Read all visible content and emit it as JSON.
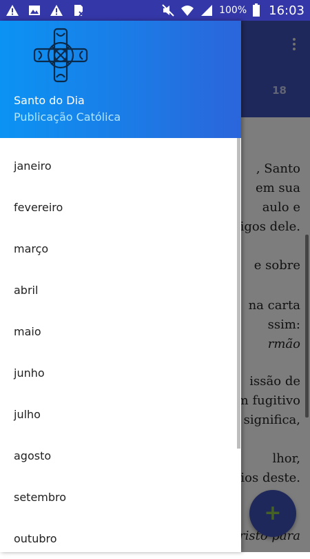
{
  "status_bar": {
    "battery": "100%",
    "time": "16:03",
    "left_icons": [
      "warning-icon",
      "image-icon",
      "warning-icon",
      "sim-icon"
    ],
    "right_icons": [
      "mute-icon",
      "wifi-icon",
      "signal-icon",
      "battery-icon"
    ]
  },
  "drawer": {
    "title": "Santo do Dia",
    "subtitle": "Publicação Católica",
    "logo_icon": "celtic-cross-icon",
    "items": [
      {
        "label": "janeiro"
      },
      {
        "label": "fevereiro"
      },
      {
        "label": "março"
      },
      {
        "label": "abril"
      },
      {
        "label": "maio"
      },
      {
        "label": "junho"
      },
      {
        "label": "julho"
      },
      {
        "label": "agosto"
      },
      {
        "label": "setembro"
      },
      {
        "label": "outubro"
      }
    ]
  },
  "background": {
    "date": "18",
    "menu_icon": "more-vert-icon",
    "fab_icon": "plus-icon",
    "lines": [
      {
        "text": ", Santo",
        "italic": false
      },
      {
        "text": "em sua",
        "italic": false
      },
      {
        "text": "aulo e",
        "italic": false
      },
      {
        "text": "nigos dele.",
        "italic": false
      },
      {
        "text": "e sobre",
        "italic": false
      },
      {
        "text": "na carta",
        "italic": false
      },
      {
        "text": "ssim:",
        "italic": false
      },
      {
        "text": "rmão",
        "italic": true
      },
      {
        "text": "issão de",
        "italic": false
      },
      {
        "text": "m fugitivo",
        "italic": false
      },
      {
        "text": "e significa,",
        "italic": false
      },
      {
        "text": "lhor,",
        "italic": false
      },
      {
        "text": "ios deste.",
        "italic": false
      },
      {
        "text": "risto para",
        "italic": true
      }
    ]
  },
  "colors": {
    "status_bar": "#3437a7",
    "app_bar": "#3f51b5",
    "drawer_header_start": "#0b93f3",
    "drawer_header_end": "#2b65db",
    "fab_plus": "#8bc34a"
  }
}
